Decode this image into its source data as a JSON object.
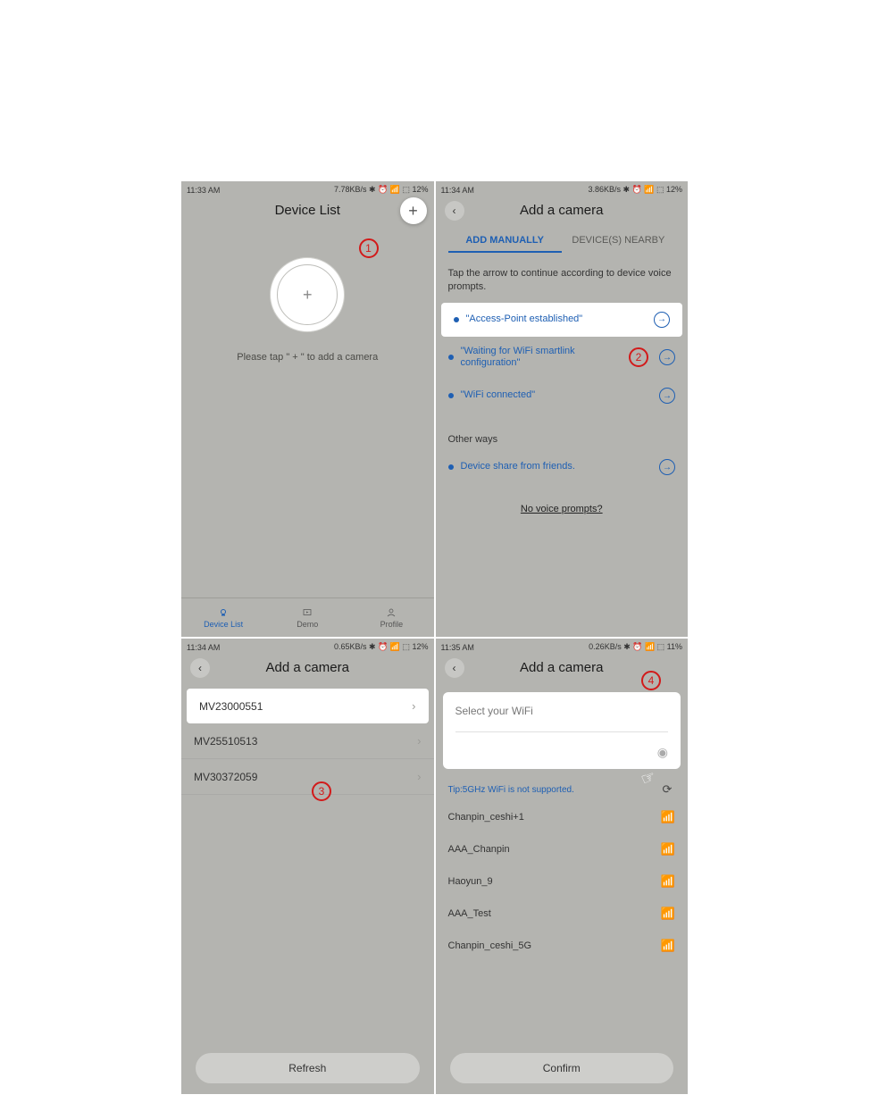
{
  "status": {
    "p1": {
      "time": "11:33 AM",
      "right": "7.78KB/s ✱ ⏰ 📶 ⬚ 12%"
    },
    "p2": {
      "time": "11:34 AM",
      "right": "3.86KB/s ✱ ⏰ 📶 ⬚ 12%"
    },
    "p3": {
      "time": "11:34 AM",
      "right": "0.65KB/s ✱ ⏰ 📶 ⬚ 12%"
    },
    "p4": {
      "time": "11:35 AM",
      "right": "0.26KB/s ✱ ⏰ 📶 ⬚ 11%"
    }
  },
  "p1": {
    "title": "Device List",
    "hint": "Please tap  \" + \"  to add a camera",
    "nav": {
      "device": "Device List",
      "demo": "Demo",
      "profile": "Profile"
    }
  },
  "p2": {
    "title": "Add a camera",
    "tabs": {
      "manual": "ADD MANUALLY",
      "nearby": "DEVICE(S) NEARBY"
    },
    "instr": "Tap the arrow to continue according to device voice prompts.",
    "opt1": "\"Access-Point established\"",
    "opt2": "\"Waiting for WiFi smartlink configuration\"",
    "opt3": "\"WiFi connected\"",
    "other_hdr": "Other ways",
    "opt4": "Device share from friends.",
    "novoice": "No voice prompts?"
  },
  "p3": {
    "title": "Add a camera",
    "devices": [
      "MV23000551",
      "MV25510513",
      "MV30372059"
    ],
    "refresh": "Refresh"
  },
  "p4": {
    "title": "Add a camera",
    "placeholder": "Select your WiFi",
    "tip": "Tip:5GHz WiFi is not supported.",
    "networks": [
      "Chanpin_ceshi+1",
      "AAA_Chanpin",
      "Haoyun_9",
      "AAA_Test",
      "Chanpin_ceshi_5G"
    ],
    "confirm": "Confirm"
  },
  "annotations": {
    "a1": "1",
    "a2": "2",
    "a3": "3",
    "a4": "4"
  }
}
